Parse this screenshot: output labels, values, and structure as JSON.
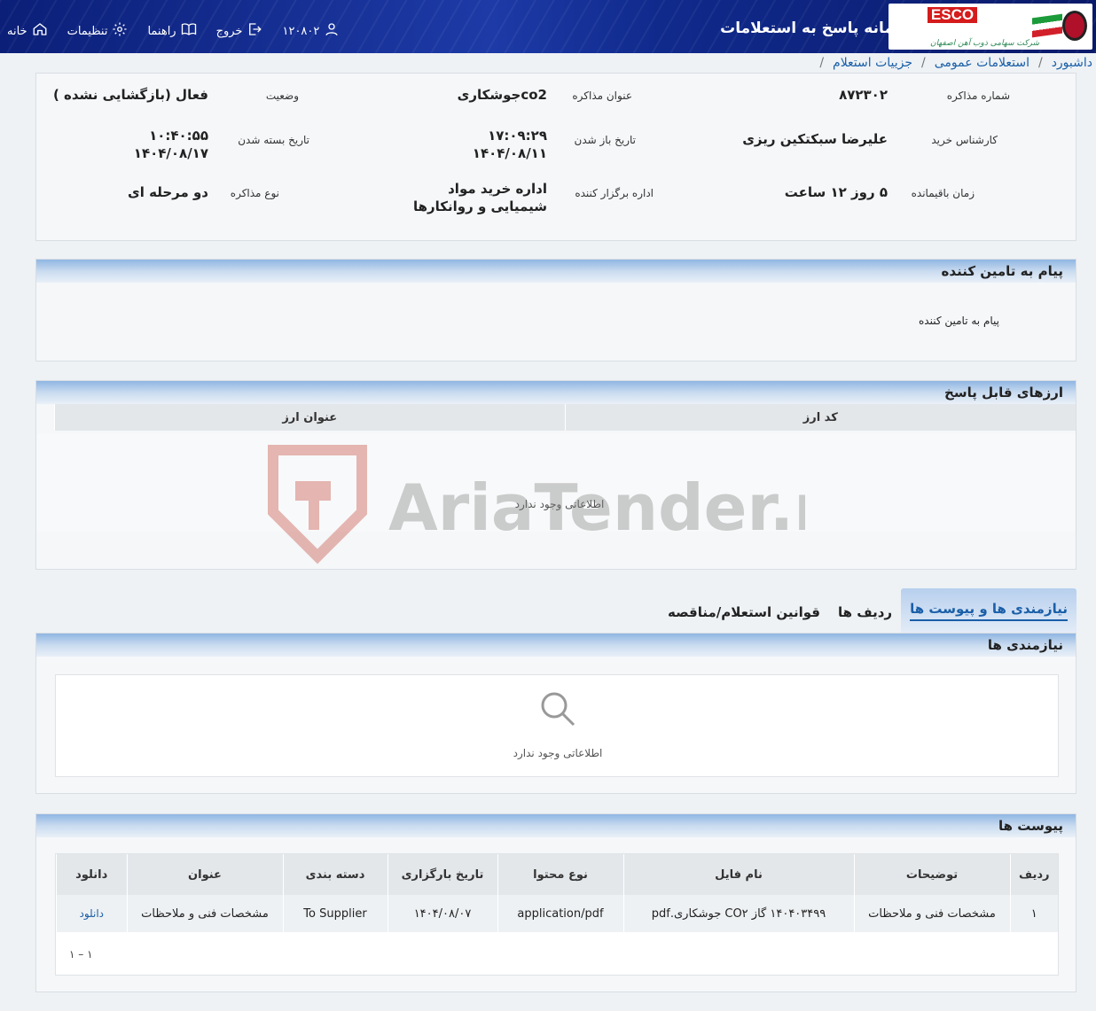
{
  "header": {
    "app_title": "سامانه پاسخ به استعلامات",
    "logo_text": "ESCO",
    "logo_subtitle": "شرکت سهامی ذوب آهن اصفهان",
    "nav": [
      {
        "label": "خانه",
        "icon": "home-icon"
      },
      {
        "label": "تنظیمات",
        "icon": "gear-icon"
      },
      {
        "label": "راهنما",
        "icon": "book-icon"
      },
      {
        "label": "خروج",
        "icon": "logout-icon"
      }
    ],
    "user_id": "۱۲۰۸۰۲"
  },
  "breadcrumb": [
    "داشبورد",
    "استعلامات عمومی",
    "جزییات استعلام"
  ],
  "info": {
    "number_label": "شماره مذاکره",
    "number_value": "۸۷۲۳۰۲",
    "title_label": "عنوان مذاکره",
    "title_value": "co2جوشکاری",
    "status_label": "وضعیت",
    "status_value": "فعال (بازگشایی نشده )",
    "expert_label": "کارشناس خرید",
    "expert_value": "علیرضا سبکتکین ریزی",
    "open_label": "تاریخ باز شدن",
    "open_time": "۱۷:۰۹:۲۹",
    "open_date": "۱۴۰۴/۰۸/۱۱",
    "close_label": "تاریخ بسته شدن",
    "close_time": "۱۰:۴۰:۵۵",
    "close_date": "۱۴۰۴/۰۸/۱۷",
    "remaining_label": "زمان باقیمانده",
    "remaining_value": "۵ روز ۱۲ ساعت",
    "dept_label": "اداره برگزار کننده",
    "dept_value": "اداره خرید مواد شیمیایی و روانکارها",
    "type_label": "نوع مذاکره",
    "type_value": "دو مرحله ای"
  },
  "supplier_msg": {
    "title": "پیام به تامین کننده",
    "body": "پیام به تامین کننده"
  },
  "currencies": {
    "title": "ارزهای قابل پاسخ",
    "columns": [
      "کد ارز",
      "عنوان ارز"
    ],
    "empty": "اطلاعاتی وجود ندارد"
  },
  "watermark_text": "AriaTender.neT",
  "tabs": [
    "نیازمندی ها و پیوست ها",
    "ردیف ها",
    "قوانین استعلام/مناقصه"
  ],
  "requirements": {
    "title": "نیازمندی ها",
    "empty": "اطلاعاتی وجود ندارد"
  },
  "attachments": {
    "title": "پیوست ها",
    "columns": [
      "ردیف",
      "توضیحات",
      "نام فایل",
      "نوع محتوا",
      "تاریخ بارگزاری",
      "دسته بندی",
      "عنوان",
      "دانلود"
    ],
    "rows": [
      [
        "۱",
        "مشخصات فنی و ملاحظات",
        "۱۴۰۴۰۳۴۹۹ گاز CO۲ جوشکاری.pdf",
        "application/pdf",
        "۱۴۰۴/۰۸/۰۷",
        "To Supplier",
        "مشخصات فنی و ملاحظات",
        "دانلود"
      ]
    ],
    "pager": "۱ – ۱"
  }
}
